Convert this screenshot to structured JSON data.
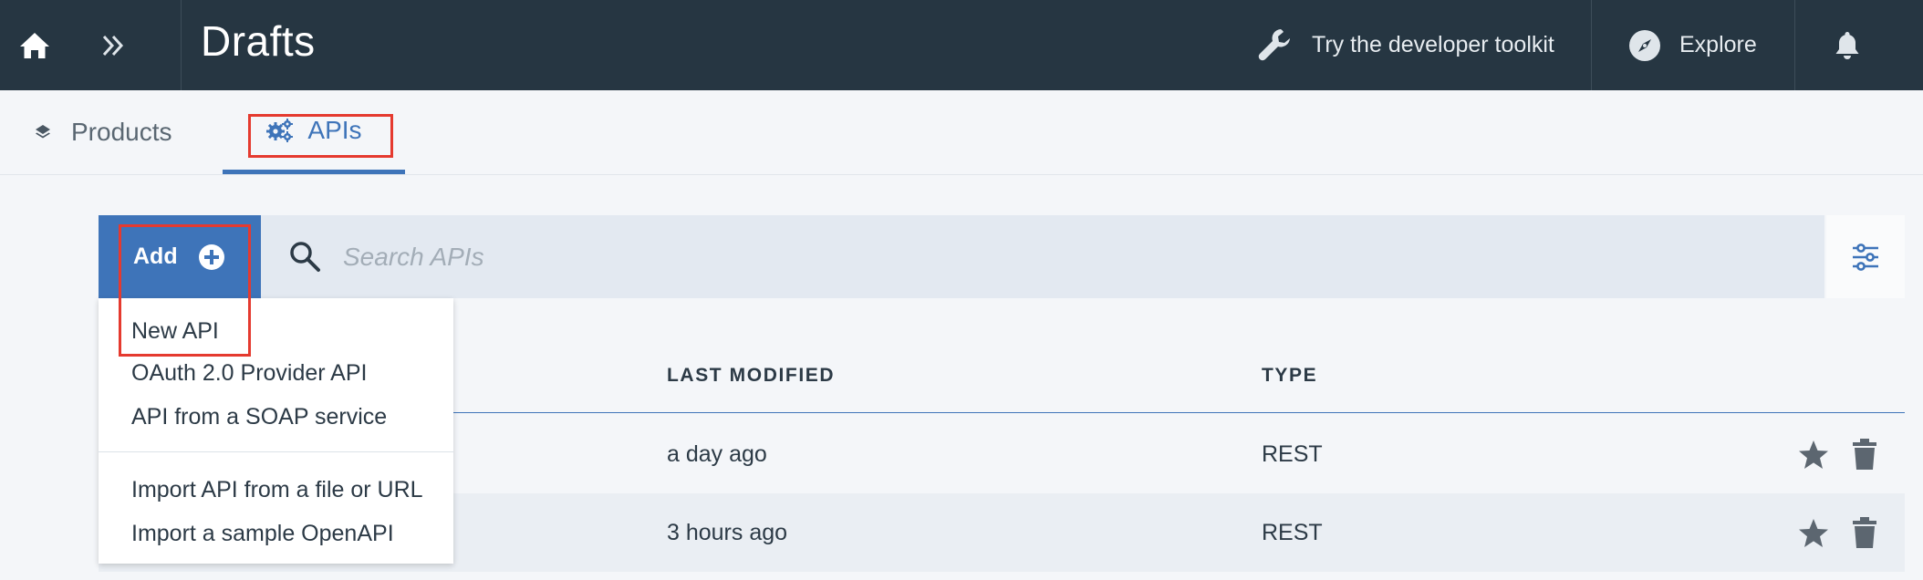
{
  "header": {
    "title": "Drafts",
    "toolkit_label": "Try the developer toolkit",
    "explore_label": "Explore"
  },
  "tabs": [
    {
      "label": "Products",
      "icon": "layers-icon"
    },
    {
      "label": "APIs",
      "icon": "gears-icon",
      "active": true
    }
  ],
  "toolbar": {
    "add_label": "Add",
    "search_placeholder": "Search APIs"
  },
  "add_menu": {
    "items": [
      "New API",
      "OAuth 2.0 Provider API",
      "API from a SOAP service"
    ],
    "import_items": [
      "Import API from a file or URL",
      "Import a sample OpenAPI"
    ]
  },
  "table": {
    "columns": [
      "LAST MODIFIED",
      "TYPE"
    ],
    "rows": [
      {
        "last_modified": "a day ago",
        "type": "REST"
      },
      {
        "last_modified": "3 hours ago",
        "type": "REST"
      }
    ]
  },
  "colors": {
    "topbar": "#263642",
    "accent": "#3e74b9",
    "highlight": "#e53a2f",
    "search_bg": "#e3e9f1"
  }
}
